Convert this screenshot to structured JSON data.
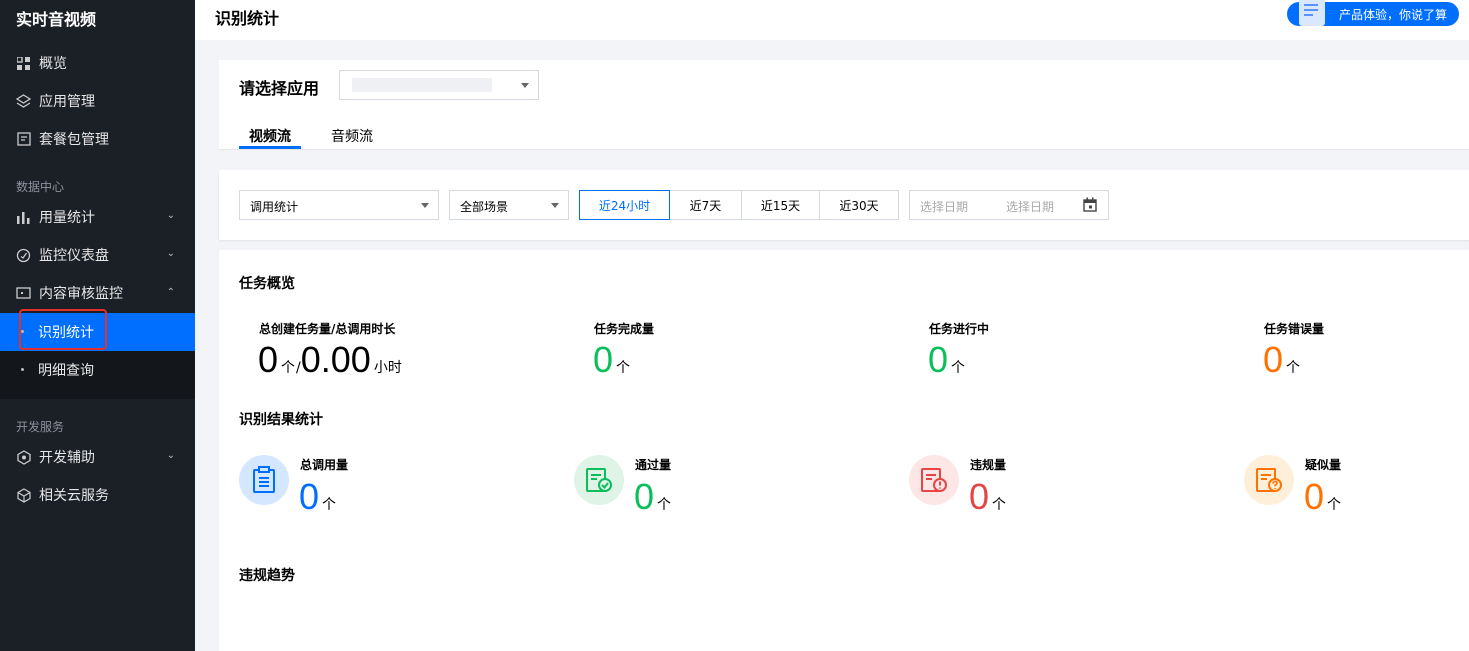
{
  "sidebar": {
    "title": "实时音视频",
    "items": [
      {
        "label": "概览"
      },
      {
        "label": "应用管理"
      },
      {
        "label": "套餐包管理"
      }
    ],
    "group_data": "数据中心",
    "data_items": [
      {
        "label": "用量统计"
      },
      {
        "label": "监控仪表盘"
      },
      {
        "label": "内容审核监控"
      }
    ],
    "sub_items": [
      {
        "label": "识别统计"
      },
      {
        "label": "明细查询"
      }
    ],
    "group_dev": "开发服务",
    "dev_items": [
      {
        "label": "开发辅助"
      },
      {
        "label": "相关云服务"
      }
    ]
  },
  "header": {
    "title": "识别统计",
    "feedback": "产品体验，你说了算"
  },
  "app_select": {
    "label": "请选择应用",
    "value": ""
  },
  "tabs": [
    {
      "label": "视频流"
    },
    {
      "label": "音频流"
    }
  ],
  "filters": {
    "type": "调用统计",
    "scene": "全部场景",
    "ranges": [
      "近24小时",
      "近7天",
      "近15天",
      "近30天"
    ],
    "active_range": "近24小时",
    "date_start_placeholder": "选择日期",
    "date_end_placeholder": "选择日期"
  },
  "overview": {
    "title": "任务概览",
    "total_label": "总创建任务量/总调用时长",
    "total_count": "0",
    "count_unit": "个",
    "separator": "/",
    "total_duration": "0.00",
    "duration_unit": "小时",
    "completed_label": "任务完成量",
    "completed": "0",
    "running_label": "任务进行中",
    "running": "0",
    "error_label": "任务错误量",
    "error": "0"
  },
  "results": {
    "title": "识别结果统计",
    "total_label": "总调用量",
    "total": "0",
    "pass_label": "通过量",
    "pass": "0",
    "violation_label": "违规量",
    "violation": "0",
    "suspect_label": "疑似量",
    "suspect": "0",
    "unit": "个"
  },
  "trend": {
    "title": "违规趋势"
  },
  "colors": {
    "primary": "#006eff",
    "green": "#0abf5b",
    "orange": "#ff7200",
    "red": "#e54545",
    "sidebar_bg": "#1b1f26"
  }
}
